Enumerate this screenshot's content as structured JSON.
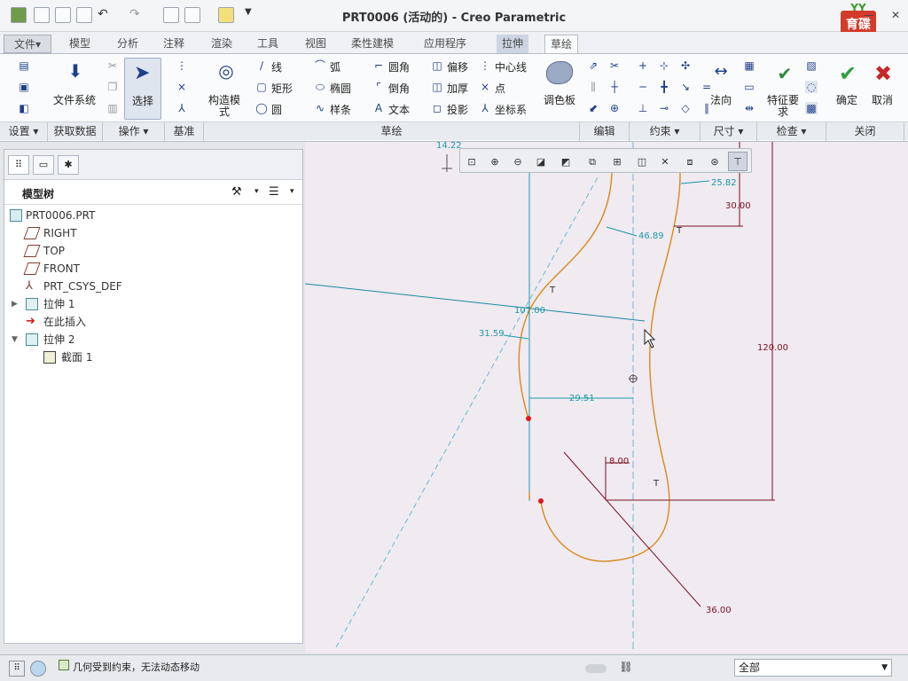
{
  "window": {
    "title": "PRT0006 (活动的) - Creo Parametric",
    "logo_text": "育碟软件",
    "logo_top": "YY"
  },
  "menu_tabs": [
    {
      "label": "文件",
      "arrow": "▾"
    },
    {
      "label": "模型"
    },
    {
      "label": "分析"
    },
    {
      "label": "注释"
    },
    {
      "label": "渲染"
    },
    {
      "label": "工具"
    },
    {
      "label": "视图"
    },
    {
      "label": "柔性建模"
    },
    {
      "label": "应用程序"
    },
    {
      "label": "拉伸"
    },
    {
      "label": "草绘"
    }
  ],
  "ribbon": {
    "file_system": "文件系统",
    "select": "选择",
    "construct_mode": "构造模式",
    "palette": "调色板",
    "line": "线",
    "arc": "弧",
    "fillet": "圆角",
    "offset": "偏移",
    "centerline": "中心线",
    "rectangle": "矩形",
    "ellipse": "椭圆",
    "chamfer": "倒角",
    "thicken": "加厚",
    "point": "点",
    "circle": "圆",
    "spline": "样条",
    "text": "文本",
    "project": "投影",
    "coord_sys": "坐标系",
    "normal": "法向",
    "feature_req": "特征要求",
    "ok": "确定",
    "cancel": "取消"
  },
  "ribbon_groups": [
    {
      "label": "设置 ▾"
    },
    {
      "label": "获取数据"
    },
    {
      "label": "操作 ▾"
    },
    {
      "label": "基准"
    },
    {
      "label": "草绘"
    },
    {
      "label": "编辑"
    },
    {
      "label": "约束 ▾"
    },
    {
      "label": "尺寸 ▾"
    },
    {
      "label": "检查 ▾"
    },
    {
      "label": "关闭"
    }
  ],
  "model_tree": {
    "title": "模型树",
    "items": [
      {
        "label": "PRT0006.PRT"
      },
      {
        "label": "RIGHT"
      },
      {
        "label": "TOP"
      },
      {
        "label": "FRONT"
      },
      {
        "label": "PRT_CSYS_DEF"
      },
      {
        "label": "拉伸 1"
      },
      {
        "label": "在此插入"
      },
      {
        "label": "拉伸 2"
      },
      {
        "label": "截面 1"
      }
    ]
  },
  "sketch": {
    "dims": {
      "d1": "14.22",
      "d2": "25.82",
      "d3": "30.00",
      "d4": "46.89",
      "d5": "107.00",
      "d6": "31.59",
      "d7": "120.00",
      "d8": "29.51",
      "d9": "8.00",
      "d10": "36.00"
    },
    "constraint_label": "T",
    "colors": {
      "geometry": "#d98a1a",
      "dimension": "#1a9aa8",
      "strong_dim": "#7a1020",
      "construction": "#6cb8d8",
      "background": "#f0eaf1"
    }
  },
  "status": {
    "message": "几何受到约束，无法动态移动",
    "filter": "全部"
  }
}
